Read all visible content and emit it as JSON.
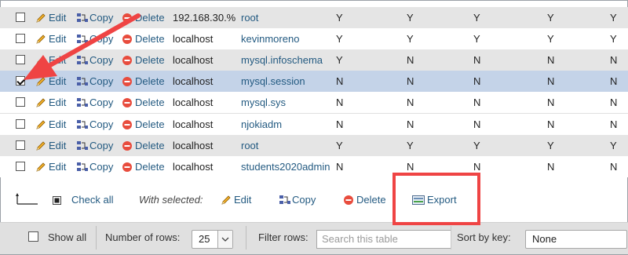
{
  "actions": {
    "edit": "Edit",
    "copy": "Copy",
    "delete": "Delete"
  },
  "rows": [
    {
      "host": "192.168.30.%",
      "user": "root",
      "privs": [
        "Y",
        "Y",
        "Y",
        "Y",
        "Y"
      ],
      "checked": false
    },
    {
      "host": "localhost",
      "user": "kevinmoreno",
      "privs": [
        "Y",
        "Y",
        "Y",
        "Y",
        "Y"
      ],
      "checked": false
    },
    {
      "host": "localhost",
      "user": "mysql.infoschema",
      "privs": [
        "Y",
        "N",
        "N",
        "N",
        "N"
      ],
      "checked": false
    },
    {
      "host": "localhost",
      "user": "mysql.session",
      "privs": [
        "N",
        "N",
        "N",
        "N",
        "N"
      ],
      "checked": true
    },
    {
      "host": "localhost",
      "user": "mysql.sys",
      "privs": [
        "N",
        "N",
        "N",
        "N",
        "N"
      ],
      "checked": false
    },
    {
      "host": "localhost",
      "user": "njokiadm",
      "privs": [
        "N",
        "N",
        "N",
        "N",
        "N"
      ],
      "checked": false
    },
    {
      "host": "localhost",
      "user": "root",
      "privs": [
        "Y",
        "Y",
        "Y",
        "Y",
        "Y"
      ],
      "checked": false
    },
    {
      "host": "localhost",
      "user": "students2020admin",
      "privs": [
        "N",
        "N",
        "N",
        "N",
        "N"
      ],
      "checked": false
    }
  ],
  "with_selected": {
    "check_all": "Check all",
    "label": "With selected:",
    "edit": "Edit",
    "copy": "Copy",
    "delete": "Delete",
    "export": "Export"
  },
  "bottom_bar": {
    "show_all": "Show all",
    "number_of_rows_label": "Number of rows:",
    "number_of_rows_value": "25",
    "filter_rows_label": "Filter rows:",
    "filter_placeholder": "Search this table",
    "sort_by_key_label": "Sort by key:",
    "sort_by_key_value": "None"
  },
  "colors": {
    "annotation_red": "#ef4444",
    "link_blue": "#235a81",
    "marked_row": "#c4d3e8"
  }
}
